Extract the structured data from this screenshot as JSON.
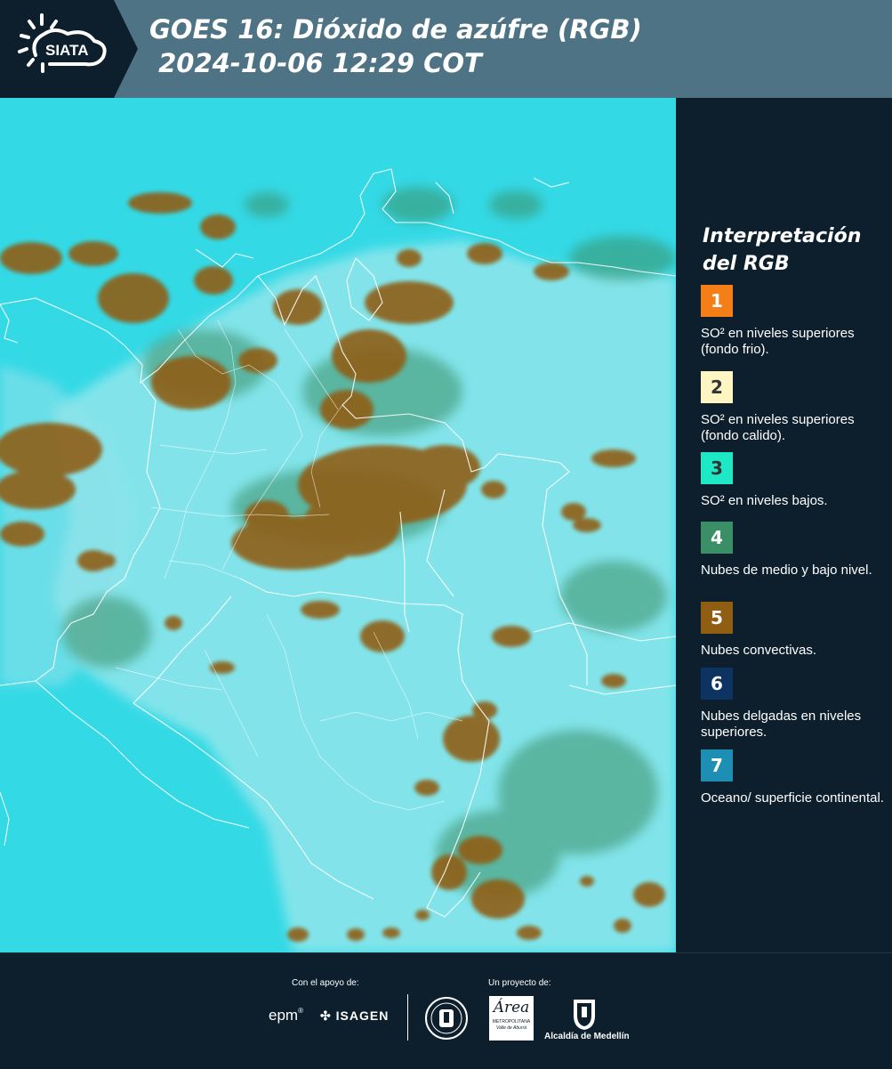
{
  "header": {
    "title": "GOES 16: Dióxido de azúfre (RGB)\n 2024-10-06 12:29 COT",
    "logo_text": "SIATA"
  },
  "legend": {
    "title": "Interpretación del RGB",
    "items": [
      {
        "number": "1",
        "label": "SO² en niveles superiores (fondo frio).",
        "color": "#f57f17"
      },
      {
        "number": "2",
        "label": "SO² en niveles superiores (fondo calido).",
        "color": "#fdf6c3"
      },
      {
        "number": "3",
        "label": "SO² en niveles bajos.",
        "color": "#1de9c6"
      },
      {
        "number": "4",
        "label": "Nubes de medio y bajo nivel.",
        "color": "#3a8f66"
      },
      {
        "number": "5",
        "label": "Nubes convectivas.",
        "color": "#8f5e12"
      },
      {
        "number": "6",
        "label": "Nubes delgadas en niveles superiores.",
        "color": "#0d3362"
      },
      {
        "number": "7",
        "label": "Oceano/ superficie continental.",
        "color": "#1d8fb5"
      }
    ]
  },
  "map": {
    "ocean_color": "#34d9e6",
    "land_color": "#9de8ec",
    "cloud_colors": [
      "#8f5e12",
      "#3a8f66"
    ]
  },
  "footer": {
    "support_caption": "Con el apoyo de:",
    "project_caption": "Un proyecto de:",
    "logos": {
      "epm": "epm",
      "isagen": "ISAGEN",
      "metropolitana": "Área",
      "metropolitana_sub": "METROPOLITANA",
      "metropolitana_sub2": "Valle de Aburrá",
      "alcaldia": "Alcaldía de Medellín"
    }
  }
}
